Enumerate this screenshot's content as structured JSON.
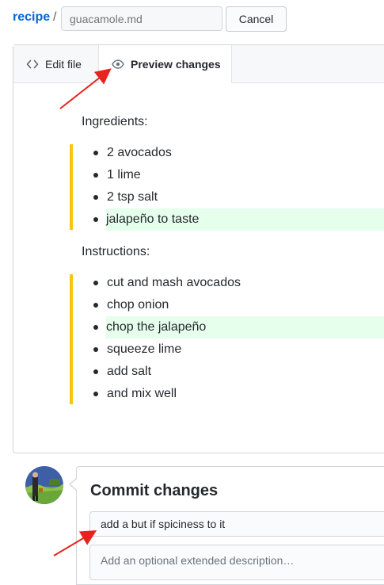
{
  "header": {
    "repo_name": "recipe",
    "separator": "/",
    "filename_placeholder": "guacamole.md",
    "cancel_label": "Cancel"
  },
  "tabs": {
    "edit_label": "Edit file",
    "preview_label": "Preview changes",
    "edit_icon": "code-icon",
    "preview_icon": "eye-icon",
    "active": "preview"
  },
  "preview": {
    "ingredients_heading": "Ingredients:",
    "ingredients": [
      {
        "text": "2 avocados",
        "added": false
      },
      {
        "text": "1 lime",
        "added": false
      },
      {
        "text": "2 tsp salt",
        "added": false
      },
      {
        "text": "jalapeño to taste",
        "added": true
      }
    ],
    "instructions_heading": "Instructions:",
    "instructions": [
      {
        "text": "cut and mash avocados",
        "added": false
      },
      {
        "text": "chop onion",
        "added": false
      },
      {
        "text": "chop the jalapeño",
        "added": true
      },
      {
        "text": "squeeze lime",
        "added": false
      },
      {
        "text": "add salt",
        "added": false
      },
      {
        "text": "and mix well",
        "added": false
      }
    ]
  },
  "commit": {
    "title": "Commit changes",
    "summary_value": "add a but if spiciness to it",
    "description_placeholder": "Add an optional extended description…"
  },
  "colors": {
    "link": "#0366d6",
    "changed_bar": "#f9c513",
    "added_bg": "#e6ffec",
    "annotation_arrow": "#e8231f"
  }
}
